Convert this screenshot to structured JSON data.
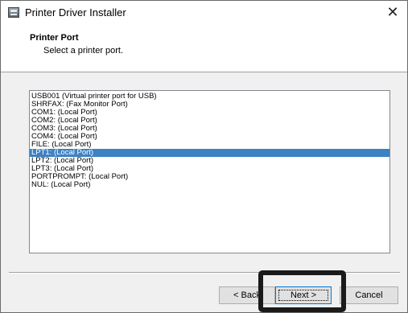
{
  "window": {
    "title": "Printer Driver Installer",
    "close_glyph": "✕"
  },
  "header": {
    "title": "Printer Port",
    "subtitle": "Select a printer port."
  },
  "port_list": {
    "items": [
      "USB001  (Virtual printer port for USB)",
      "SHRFAX:  (Fax Monitor Port)",
      "COM1:  (Local Port)",
      "COM2:  (Local Port)",
      "COM3:  (Local Port)",
      "COM4:  (Local Port)",
      "FILE:  (Local Port)",
      "LPT1:  (Local Port)",
      "LPT2:  (Local Port)",
      "LPT3:  (Local Port)",
      "PORTPROMPT:  (Local Port)",
      "NUL:  (Local Port)"
    ],
    "selected_index": 7
  },
  "buttons": {
    "back_label": "< Back",
    "next_label": "Next >",
    "cancel_label": "Cancel"
  },
  "colors": {
    "selection": "#3d82c3",
    "highlight_frame": "#1a1a1a"
  }
}
